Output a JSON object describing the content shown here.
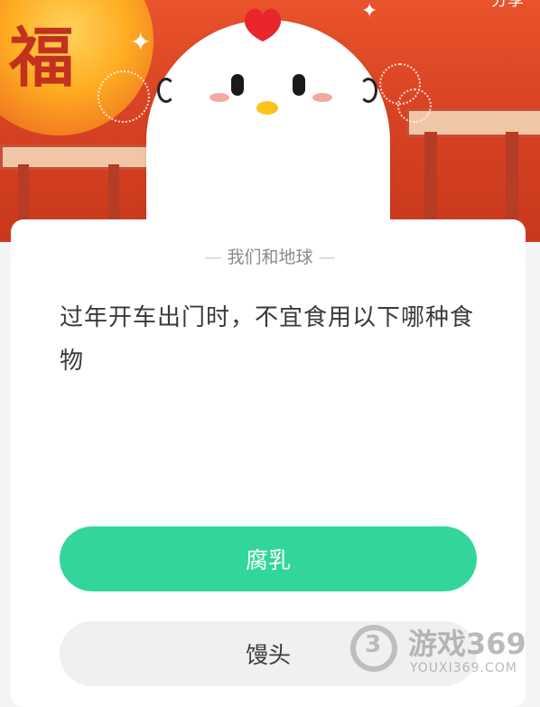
{
  "header": {
    "share_label": "分享",
    "lantern_char": "福"
  },
  "section_title": "我们和地球",
  "question": "过年开车出门时，不宜食用以下哪种食物",
  "options": [
    {
      "label": "腐乳",
      "selected": true
    },
    {
      "label": "馒头",
      "selected": false
    }
  ],
  "watermark": {
    "mark": "3",
    "name": "游戏369",
    "url": "YOUXI369.COM"
  },
  "colors": {
    "banner": "#d84323",
    "accent_green": "#33d69a",
    "option_gray": "#eef0f2"
  }
}
